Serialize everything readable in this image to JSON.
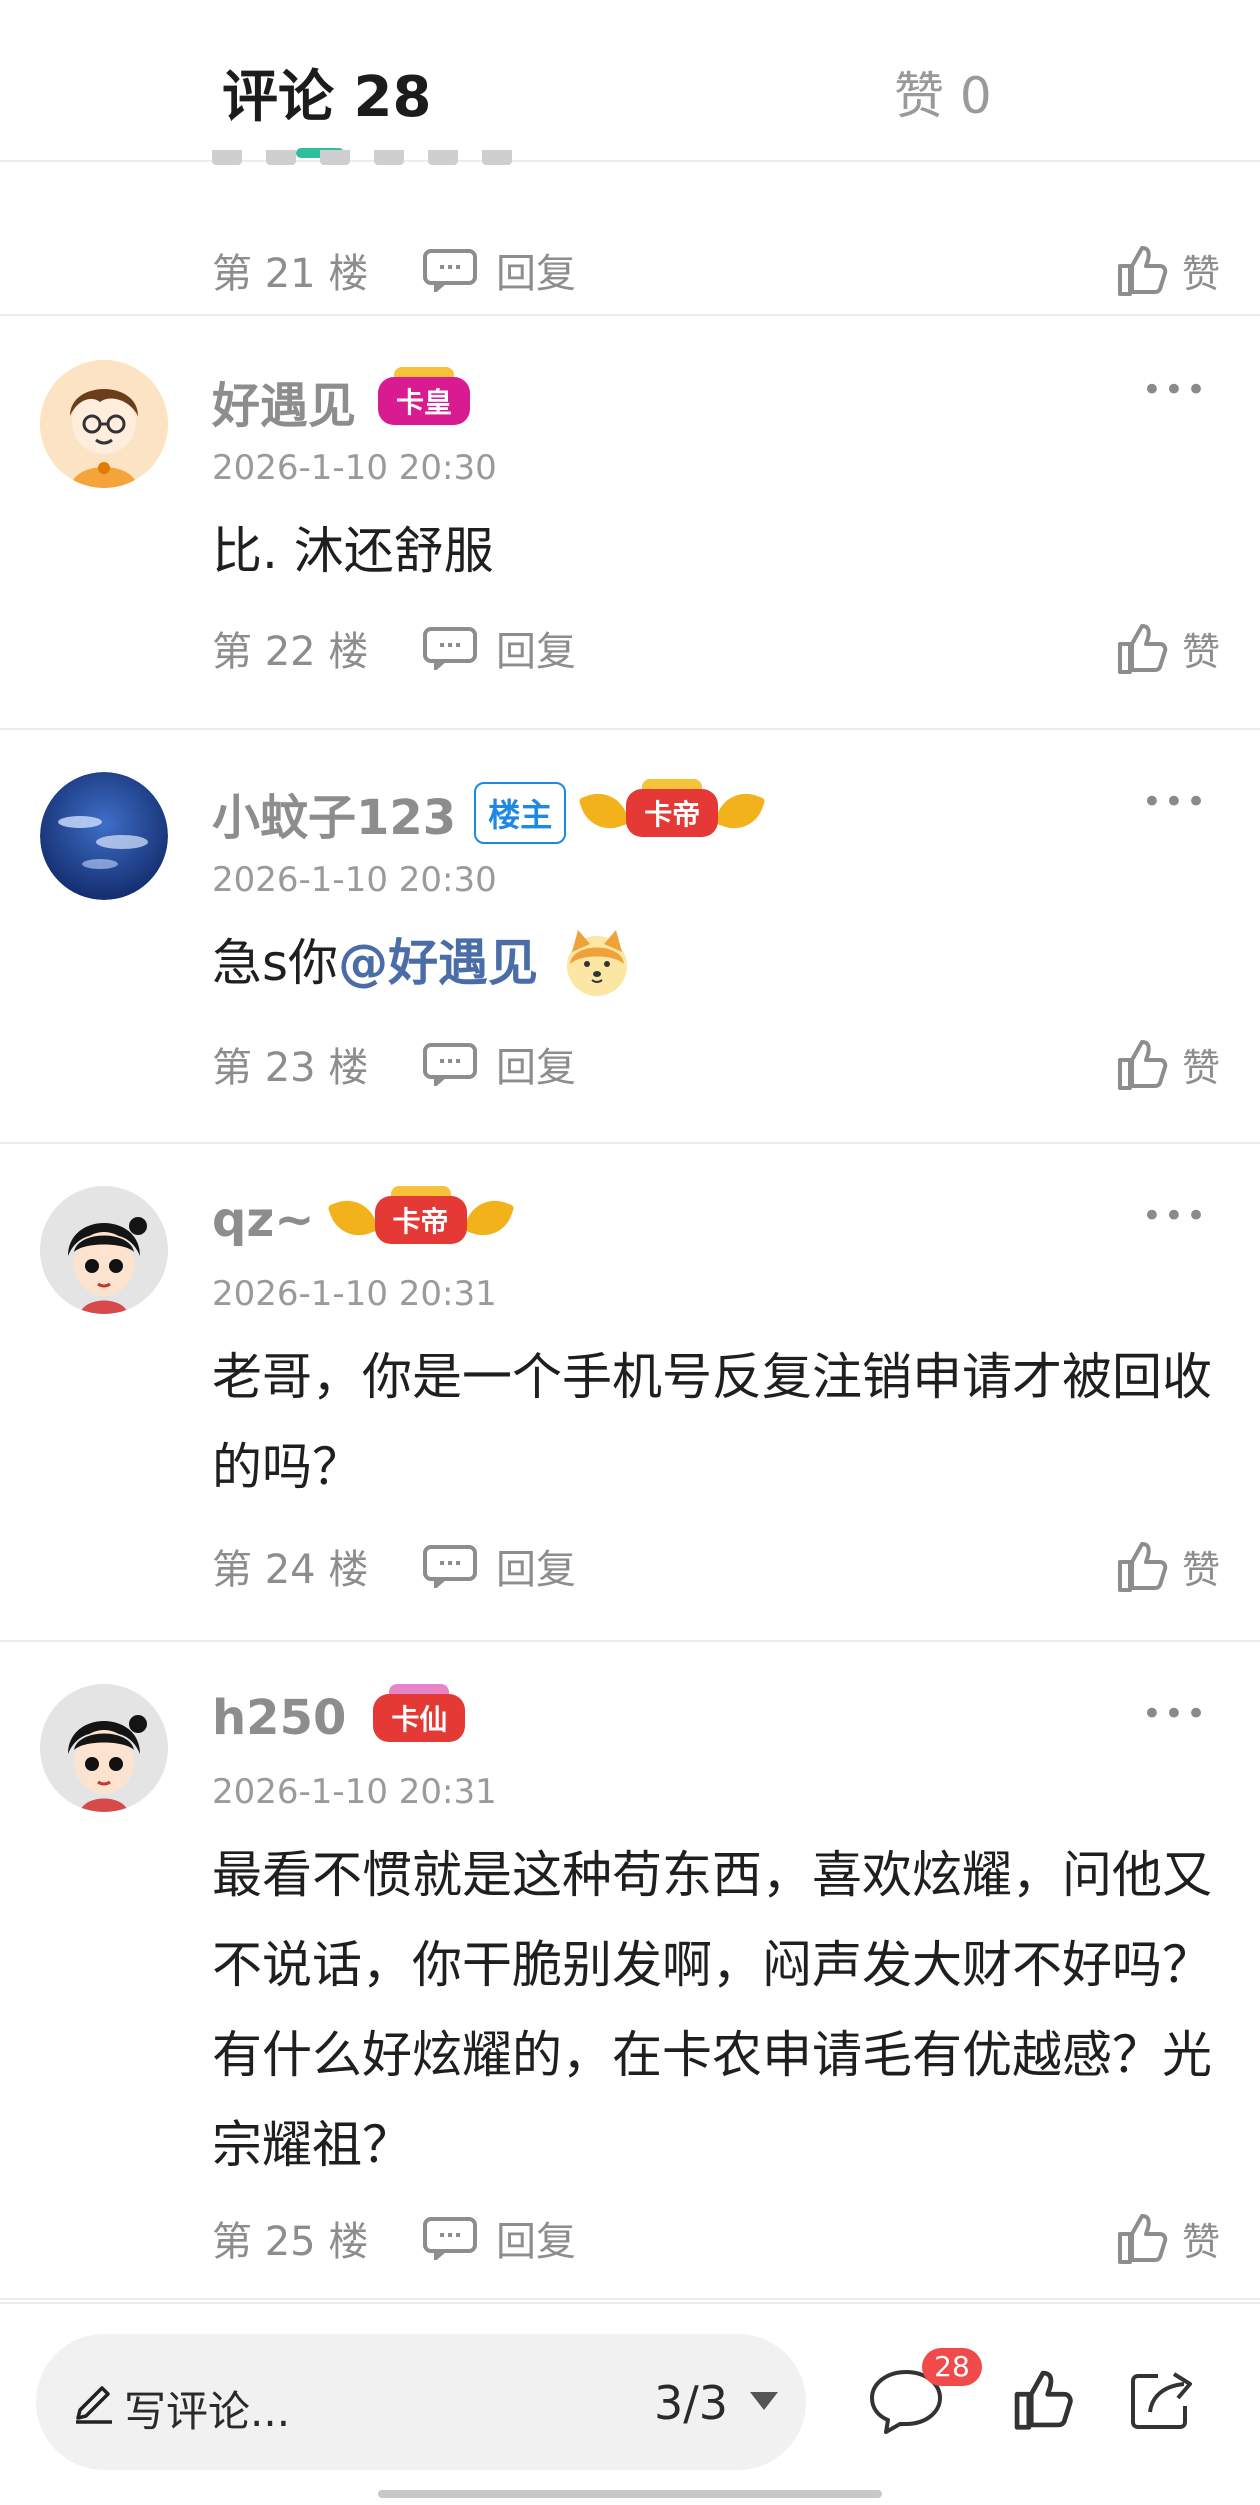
{
  "header": {
    "comments_tab": "评论 28",
    "likes_tab": "赞 0"
  },
  "partial_post": {
    "floor": "第 21 楼",
    "reply_label": "回复",
    "like_label": "赞"
  },
  "posts": [
    {
      "username": "好遇见",
      "badge": "卡皇",
      "timestamp": "2026-1-10 20:30",
      "content": "比. 沐还舒服",
      "floor": "第 22 楼",
      "reply_label": "回复",
      "like_label": "赞"
    },
    {
      "username": "小蚊子123",
      "host_badge": "楼主",
      "badge": "卡帝",
      "timestamp": "2026-1-10 20:30",
      "content_prefix": "急s你",
      "mention": "@好遇见",
      "emoji": "shiba-dog-emoji",
      "floor": "第 23 楼",
      "reply_label": "回复",
      "like_label": "赞"
    },
    {
      "username": "qz~",
      "badge": "卡帝",
      "timestamp": "2026-1-10 20:31",
      "content": "老哥，你是一个手机号反复注销申请才被回收的吗？",
      "floor": "第 24 楼",
      "reply_label": "回复",
      "like_label": "赞"
    },
    {
      "username": "h250",
      "badge": "卡仙",
      "timestamp": "2026-1-10 20:31",
      "content": "最看不惯就是这种苟东西，喜欢炫耀，问他又不说话，你干脆别发啊，闷声发大财不好吗？有什么好炫耀的，在卡农申请毛有优越感？光宗耀祖？",
      "floor": "第 25 楼",
      "reply_label": "回复",
      "like_label": "赞"
    }
  ],
  "bottom_bar": {
    "write_placeholder": "写评论...",
    "page_indicator": "3/3",
    "comment_count": "28"
  },
  "colors": {
    "accent": "#2fbf9f",
    "mention": "#4a6da7",
    "host_badge": "#1e88e5",
    "badge_red": "#e53935",
    "badge_pink": "#d81b91"
  }
}
